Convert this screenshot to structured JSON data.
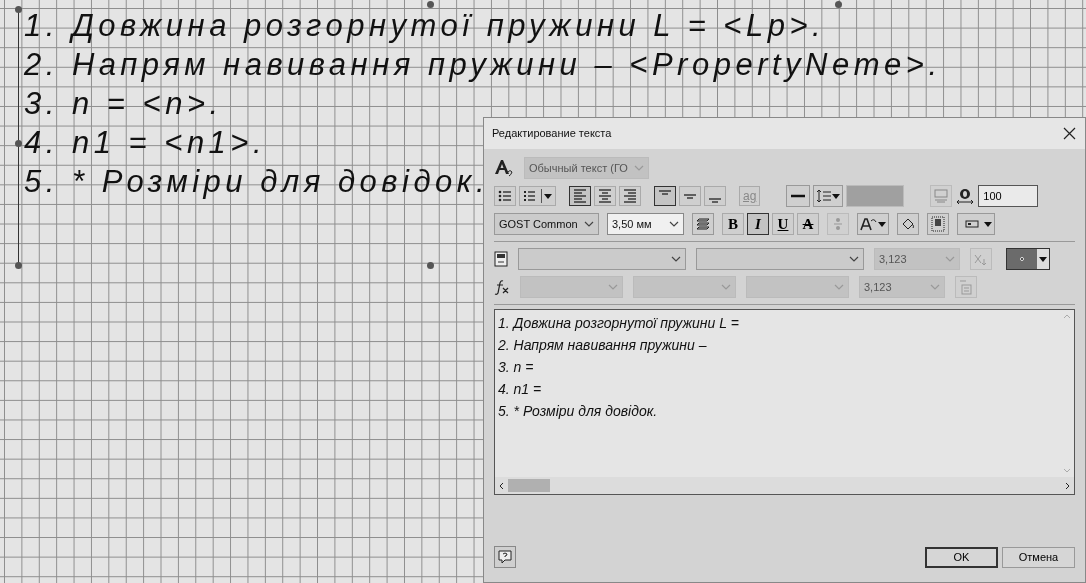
{
  "canvas": {
    "lines": [
      "1. Довжина розгорнутої пружини L = <Lp>.",
      "2. Напрям навивання пружини – <PropertyNeme>.",
      "3. n = <n>.",
      "4. n1 = <n1>.",
      "5. * Розміри для довідок."
    ]
  },
  "dialog": {
    "title": "Редактирование текста",
    "style": {
      "value": "Обычный текст (ГО",
      "disabled": true
    },
    "paragraph_buttons": [
      {
        "kind": "bullets",
        "selected": false
      },
      {
        "kind": "numbering",
        "selected": false
      },
      {
        "kind": "align-left",
        "selected": true
      },
      {
        "kind": "align-center",
        "selected": false
      },
      {
        "kind": "align-right",
        "selected": false
      },
      {
        "kind": "valign-top",
        "selected": true
      },
      {
        "kind": "valign-middle",
        "selected": false
      },
      {
        "kind": "valign-bottom",
        "selected": false
      },
      {
        "kind": "text-fill",
        "label": "ag",
        "selected": false
      }
    ],
    "width_factor": "100",
    "font": "GOST Common",
    "size": "3,50 мм",
    "format_buttons": [
      {
        "kind": "bold",
        "label": "B",
        "selected": false
      },
      {
        "kind": "italic",
        "label": "I",
        "selected": true
      },
      {
        "kind": "underline",
        "label": "U",
        "selected": false
      },
      {
        "kind": "strike",
        "label": "A",
        "selected": false
      }
    ],
    "parameter_row": {
      "precision": "3,123"
    },
    "function_row": {
      "precision": "3,123"
    },
    "editor_lines": [
      "1. Довжина розгорнутої пружини L =",
      "2. Напрям навивання пружини –",
      "3. n =",
      "4. n1 =",
      "5. * Розміри для довідок."
    ],
    "buttons": [
      "OK",
      "Отмена"
    ]
  }
}
